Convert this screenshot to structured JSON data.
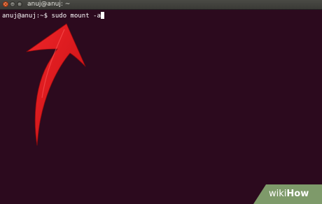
{
  "window": {
    "title": "anuj@anuj: ~",
    "buttons": {
      "close": "×",
      "minimize": "–",
      "maximize": "□"
    }
  },
  "terminal": {
    "prompt": "anuj@anuj:~$ ",
    "command": "sudo mount -a"
  },
  "watermark": {
    "part1": "wiki",
    "part2": "How"
  },
  "colors": {
    "terminal_bg": "#2c0a1e",
    "arrow": "#e01418",
    "watermark_bg": "#7e9a6a"
  },
  "icons": [
    "close-icon",
    "minimize-icon",
    "maximize-icon",
    "red-arrow-annotation"
  ]
}
